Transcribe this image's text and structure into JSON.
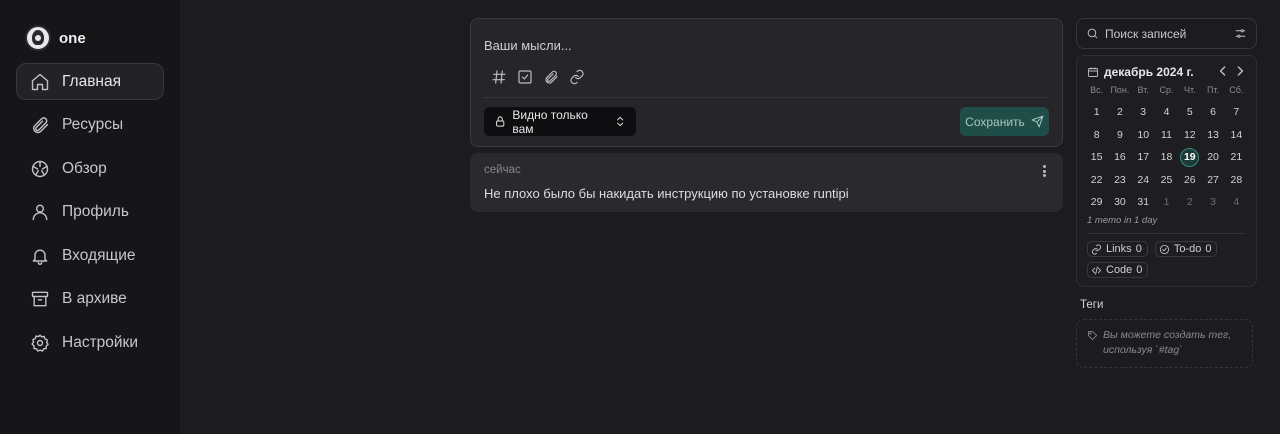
{
  "brand": {
    "name": "one"
  },
  "nav": [
    {
      "label": "Главная",
      "icon": "home-icon",
      "active": true
    },
    {
      "label": "Ресурсы",
      "icon": "paperclip-icon"
    },
    {
      "label": "Обзор",
      "icon": "compass-icon"
    },
    {
      "label": "Профиль",
      "icon": "user-icon"
    },
    {
      "label": "Входящие",
      "icon": "bell-icon"
    },
    {
      "label": "В архиве",
      "icon": "archive-icon"
    },
    {
      "label": "Настройки",
      "icon": "gear-icon"
    }
  ],
  "editor": {
    "placeholder": "Ваши мысли...",
    "toolbar": [
      "hash-icon",
      "checkbox-icon",
      "paperclip-icon",
      "link-icon"
    ],
    "visibility_label": "Видно только вам",
    "save_label": "Сохранить"
  },
  "memo": {
    "time": "сейчас",
    "text": "Не плохо было бы накидать инструкцию по установке runtipi"
  },
  "search": {
    "placeholder": "Поиск записей"
  },
  "calendar": {
    "title": "декабрь 2024 г.",
    "weekdays": [
      "Вс.",
      "Пон.",
      "Вт.",
      "Ср.",
      "Чт.",
      "Пт.",
      "Сб."
    ],
    "days": [
      "1",
      "2",
      "3",
      "4",
      "5",
      "6",
      "7",
      "8",
      "9",
      "10",
      "11",
      "12",
      "13",
      "14",
      "15",
      "16",
      "17",
      "18",
      "19",
      "20",
      "21",
      "22",
      "23",
      "24",
      "25",
      "26",
      "27",
      "28",
      "29",
      "30",
      "31",
      "1",
      "2",
      "3",
      "4"
    ],
    "today": "19",
    "summary": "1 memo in 1 day",
    "accent": "#36887f"
  },
  "stats": [
    {
      "label": "Links",
      "count": "0",
      "icon": "link-icon"
    },
    {
      "label": "To-do",
      "count": "0",
      "icon": "check-circle-icon"
    },
    {
      "label": "Code",
      "count": "0",
      "icon": "code-icon"
    }
  ],
  "tags": {
    "title": "Теги",
    "empty_text": "Вы можете создать тег, используя `#tag`"
  }
}
